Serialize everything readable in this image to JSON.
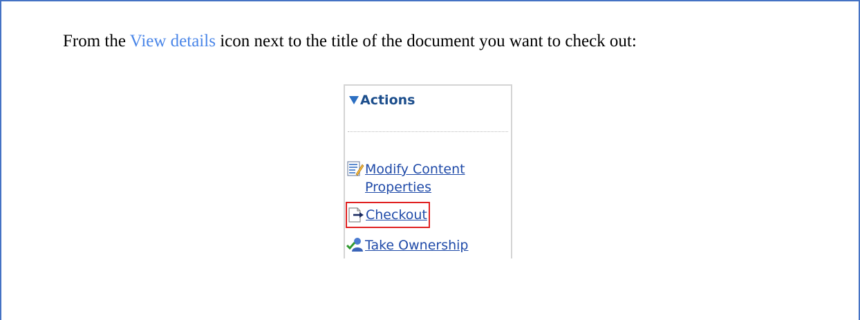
{
  "instruction": {
    "prefix": "From the ",
    "link_text": "View details",
    "suffix": " icon next to the title of the document you want to check out:"
  },
  "panel": {
    "header": "Actions",
    "header_icon": "triangle-down-icon",
    "actions": [
      {
        "label": "Modify Content Properties",
        "icon": "edit-document-icon"
      },
      {
        "label": "Checkout",
        "icon": "checkout-arrow-icon",
        "highlighted": true
      },
      {
        "label": "Take Ownership",
        "icon": "user-check-icon"
      }
    ]
  },
  "colors": {
    "frame_border": "#4472c4",
    "link": "#4a86e8",
    "action_text": "#1f4aa8",
    "header_text": "#1c4e8c",
    "highlight": "#e02020"
  }
}
